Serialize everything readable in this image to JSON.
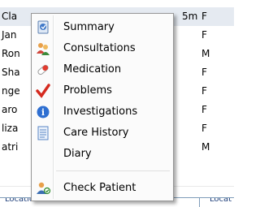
{
  "patients": [
    {
      "name": "Cla",
      "age": "5m",
      "sex": "F"
    },
    {
      "name": "Jan",
      "age": "",
      "sex": "F"
    },
    {
      "name": "Ron",
      "age": "",
      "sex": "M"
    },
    {
      "name": "Sha",
      "age": "",
      "sex": "F"
    },
    {
      "name": "nge",
      "age": "",
      "sex": "F"
    },
    {
      "name": "aro",
      "age": "",
      "sex": "F"
    },
    {
      "name": "liza",
      "age": "",
      "sex": "F"
    },
    {
      "name": "atri",
      "age": "",
      "sex": "M"
    }
  ],
  "status_bar": {
    "left_text": "Location: Ward...",
    "right_text": "Locat"
  },
  "context_menu": {
    "items": [
      {
        "label": "Summary",
        "icon": "summary-icon"
      },
      {
        "label": "Consultations",
        "icon": "consultations-icon"
      },
      {
        "label": "Medication",
        "icon": "medication-icon"
      },
      {
        "label": "Problems",
        "icon": "problems-icon"
      },
      {
        "label": "Investigations",
        "icon": "investigations-icon"
      },
      {
        "label": "Care History",
        "icon": "care-history-icon"
      },
      {
        "label": "Diary",
        "icon": ""
      }
    ],
    "bottom_item": {
      "label": "Check Patient",
      "icon": "check-patient-icon"
    }
  }
}
